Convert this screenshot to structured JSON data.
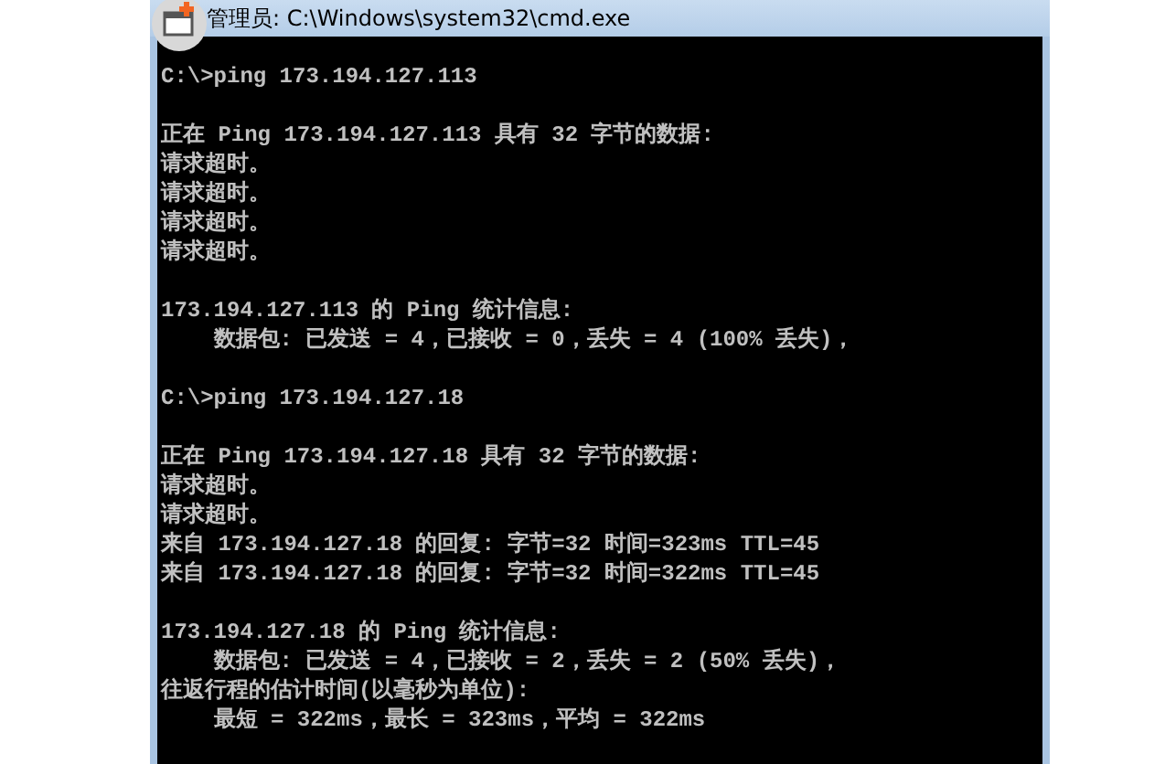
{
  "window": {
    "title": "管理员: C:\\Windows\\system32\\cmd.exe"
  },
  "console": {
    "blocks": [
      [
        "C:\\>ping 173.194.127.113"
      ],
      [
        "正在 Ping 173.194.127.113 具有 32 字节的数据:",
        "请求超时。",
        "请求超时。",
        "请求超时。",
        "请求超时。"
      ],
      [
        "173.194.127.113 的 Ping 统计信息:",
        "    数据包: 已发送 = 4，已接收 = 0，丢失 = 4 (100% 丢失)，"
      ],
      [
        "C:\\>ping 173.194.127.18"
      ],
      [
        "正在 Ping 173.194.127.18 具有 32 字节的数据:",
        "请求超时。",
        "请求超时。",
        "来自 173.194.127.18 的回复: 字节=32 时间=323ms TTL=45",
        "来自 173.194.127.18 的回复: 字节=32 时间=322ms TTL=45"
      ],
      [
        "173.194.127.18 的 Ping 统计信息:",
        "    数据包: 已发送 = 4，已接收 = 2，丢失 = 2 (50% 丢失)，",
        "往返行程的估计时间(以毫秒为单位):",
        "    最短 = 322ms，最长 = 323ms，平均 = 322ms"
      ]
    ]
  }
}
